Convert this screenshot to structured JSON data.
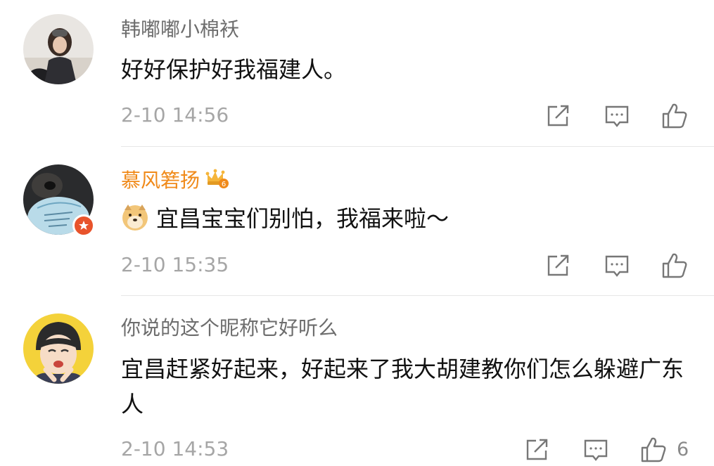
{
  "comments": [
    {
      "username": "韩嘟嘟小棉袄",
      "content": "好好保护好我福建人。",
      "timestamp": "2-10 14:56",
      "likes": ""
    },
    {
      "username": "慕风箬扬",
      "content": "宜昌宝宝们别怕，我福来啦～",
      "timestamp": "2-10 15:35",
      "likes": "",
      "vip_level": "6"
    },
    {
      "username": "你说的这个昵称它好听么",
      "content": "宜昌赶紧好起来，好起来了我大胡建教你们怎么躲避广东人",
      "timestamp": "2-10 14:53",
      "likes": "6"
    }
  ],
  "icons": {
    "repost": "share-icon",
    "comment": "comment-icon",
    "like": "thumbs-up-icon"
  },
  "colors": {
    "vip_name": "#f08a1a",
    "badge": "#e8532b"
  }
}
